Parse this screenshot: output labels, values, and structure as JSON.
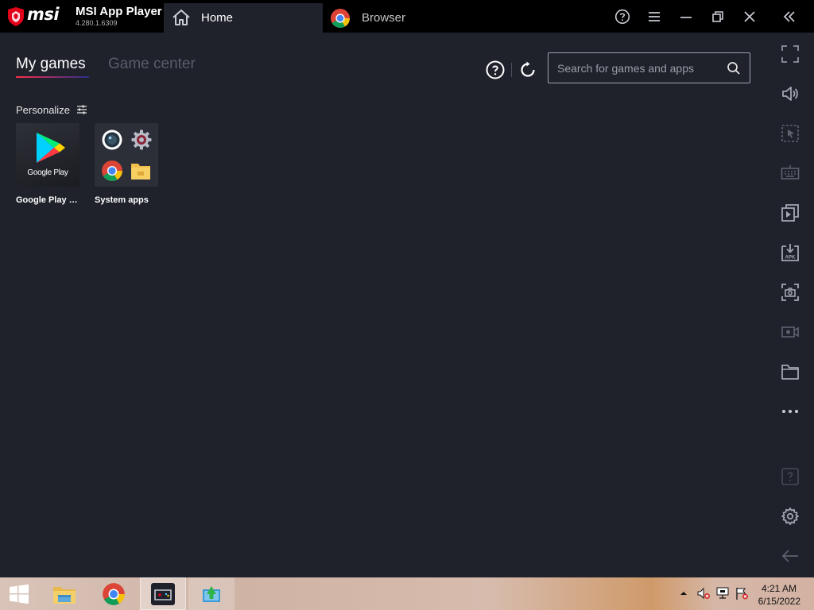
{
  "titlebar": {
    "brand": "msi",
    "app_name": "MSI App Player",
    "version": "4.280.1.6309",
    "tabs": [
      {
        "label": "Home",
        "icon": "home-icon",
        "active": true
      },
      {
        "label": "Browser",
        "icon": "chrome-icon",
        "active": false
      }
    ],
    "controls": [
      "help-icon",
      "menu-icon",
      "minimize-icon",
      "restore-icon",
      "close-icon",
      "collapse-sidebar-icon"
    ]
  },
  "main": {
    "tabs": [
      {
        "label": "My games",
        "active": true
      },
      {
        "label": "Game center",
        "active": false
      }
    ],
    "search": {
      "placeholder": "Search for games and apps",
      "value": ""
    },
    "personalize_label": "Personalize",
    "apps": [
      {
        "label": "Google Play S...",
        "caption": "Google Play",
        "icon": "google-play-icon"
      },
      {
        "label": "System apps",
        "icon": "system-apps-folder-icon"
      }
    ]
  },
  "sidebar": {
    "buttons": [
      "fullscreen-icon",
      "volume-icon",
      "pointer-select-icon",
      "keyboard-icon",
      "media-manager-icon",
      "install-apk-icon",
      "screenshot-icon",
      "record-icon",
      "folder-icon",
      "more-icon",
      "help-icon",
      "settings-icon",
      "back-icon"
    ]
  },
  "taskbar": {
    "items": [
      "windows-start-icon",
      "file-explorer-icon",
      "chrome-icon",
      "msi-app-player-icon",
      "installer-icon"
    ],
    "tray_icons": [
      "show-hidden-icons-arrow",
      "volume-muted-icon",
      "network-icon",
      "action-center-flag-icon"
    ],
    "time": "4:21 AM",
    "date": "6/15/2022"
  },
  "colors": {
    "background": "#1f212b",
    "titlebar": "#000000",
    "brand_red": "#e2001a",
    "inactive_tab_text": "#5a5d6b",
    "taskbar": "#d3b1a3"
  }
}
